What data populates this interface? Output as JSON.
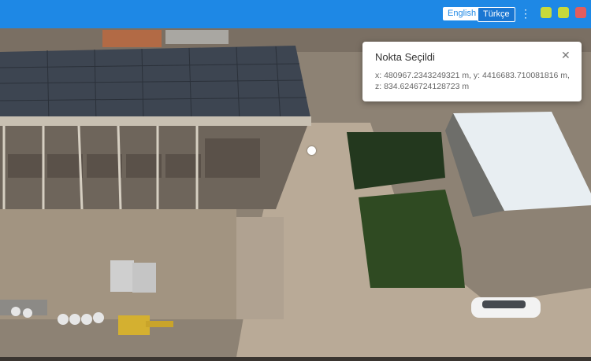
{
  "header": {
    "lang_english": "English",
    "lang_turkish": "Türkçe",
    "menu_icon": "more-vertical-icon",
    "window_buttons": [
      {
        "name": "minimize",
        "color": "#c8d93a"
      },
      {
        "name": "maximize",
        "color": "#c8d93a"
      },
      {
        "name": "close",
        "color": "#e35d5d"
      }
    ],
    "bar_color": "#1e88e5"
  },
  "popup": {
    "title": "Nokta Seçildi",
    "close_icon": "close-icon",
    "coordinates": "x: 480967.2343249321 m, y: 4416683.710081816 m, z: 834.6246724128723 m"
  },
  "map": {
    "marker_color": "#ffffff"
  }
}
